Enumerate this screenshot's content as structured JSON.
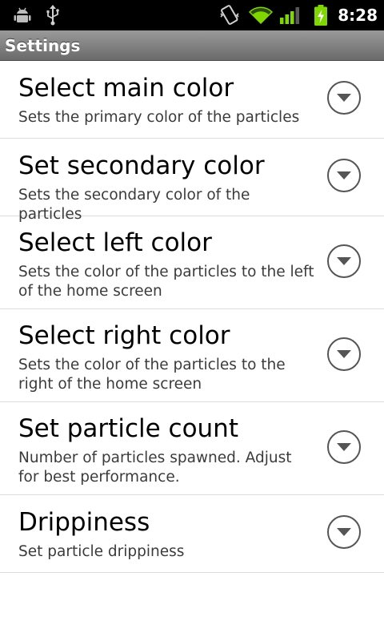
{
  "status_bar": {
    "time": "8:28",
    "icons": [
      "debug-icon",
      "usb-icon",
      "vibrate-icon",
      "wifi-icon",
      "signal-icon",
      "battery-charging-icon"
    ]
  },
  "title_bar": {
    "title": "Settings"
  },
  "settings": [
    {
      "title": "Select main color",
      "summary": "Sets the primary color of the particles"
    },
    {
      "title": "Set secondary color",
      "summary": "Sets the secondary color of the particles"
    },
    {
      "title": "Select left color",
      "summary": "Sets the color of the particles to the left of the home screen"
    },
    {
      "title": "Select right color",
      "summary": "Sets the color of the particles to the right of the home screen"
    },
    {
      "title": "Set particle count",
      "summary": "Number of particles spawned. Adjust for best performance."
    },
    {
      "title": "Drippiness",
      "summary": "Set particle drippiness"
    }
  ],
  "colors": {
    "status_bar": "#000000",
    "wifi": "#7fd600",
    "battery": "#7fd600",
    "title_bar": "#7a7a7a"
  }
}
